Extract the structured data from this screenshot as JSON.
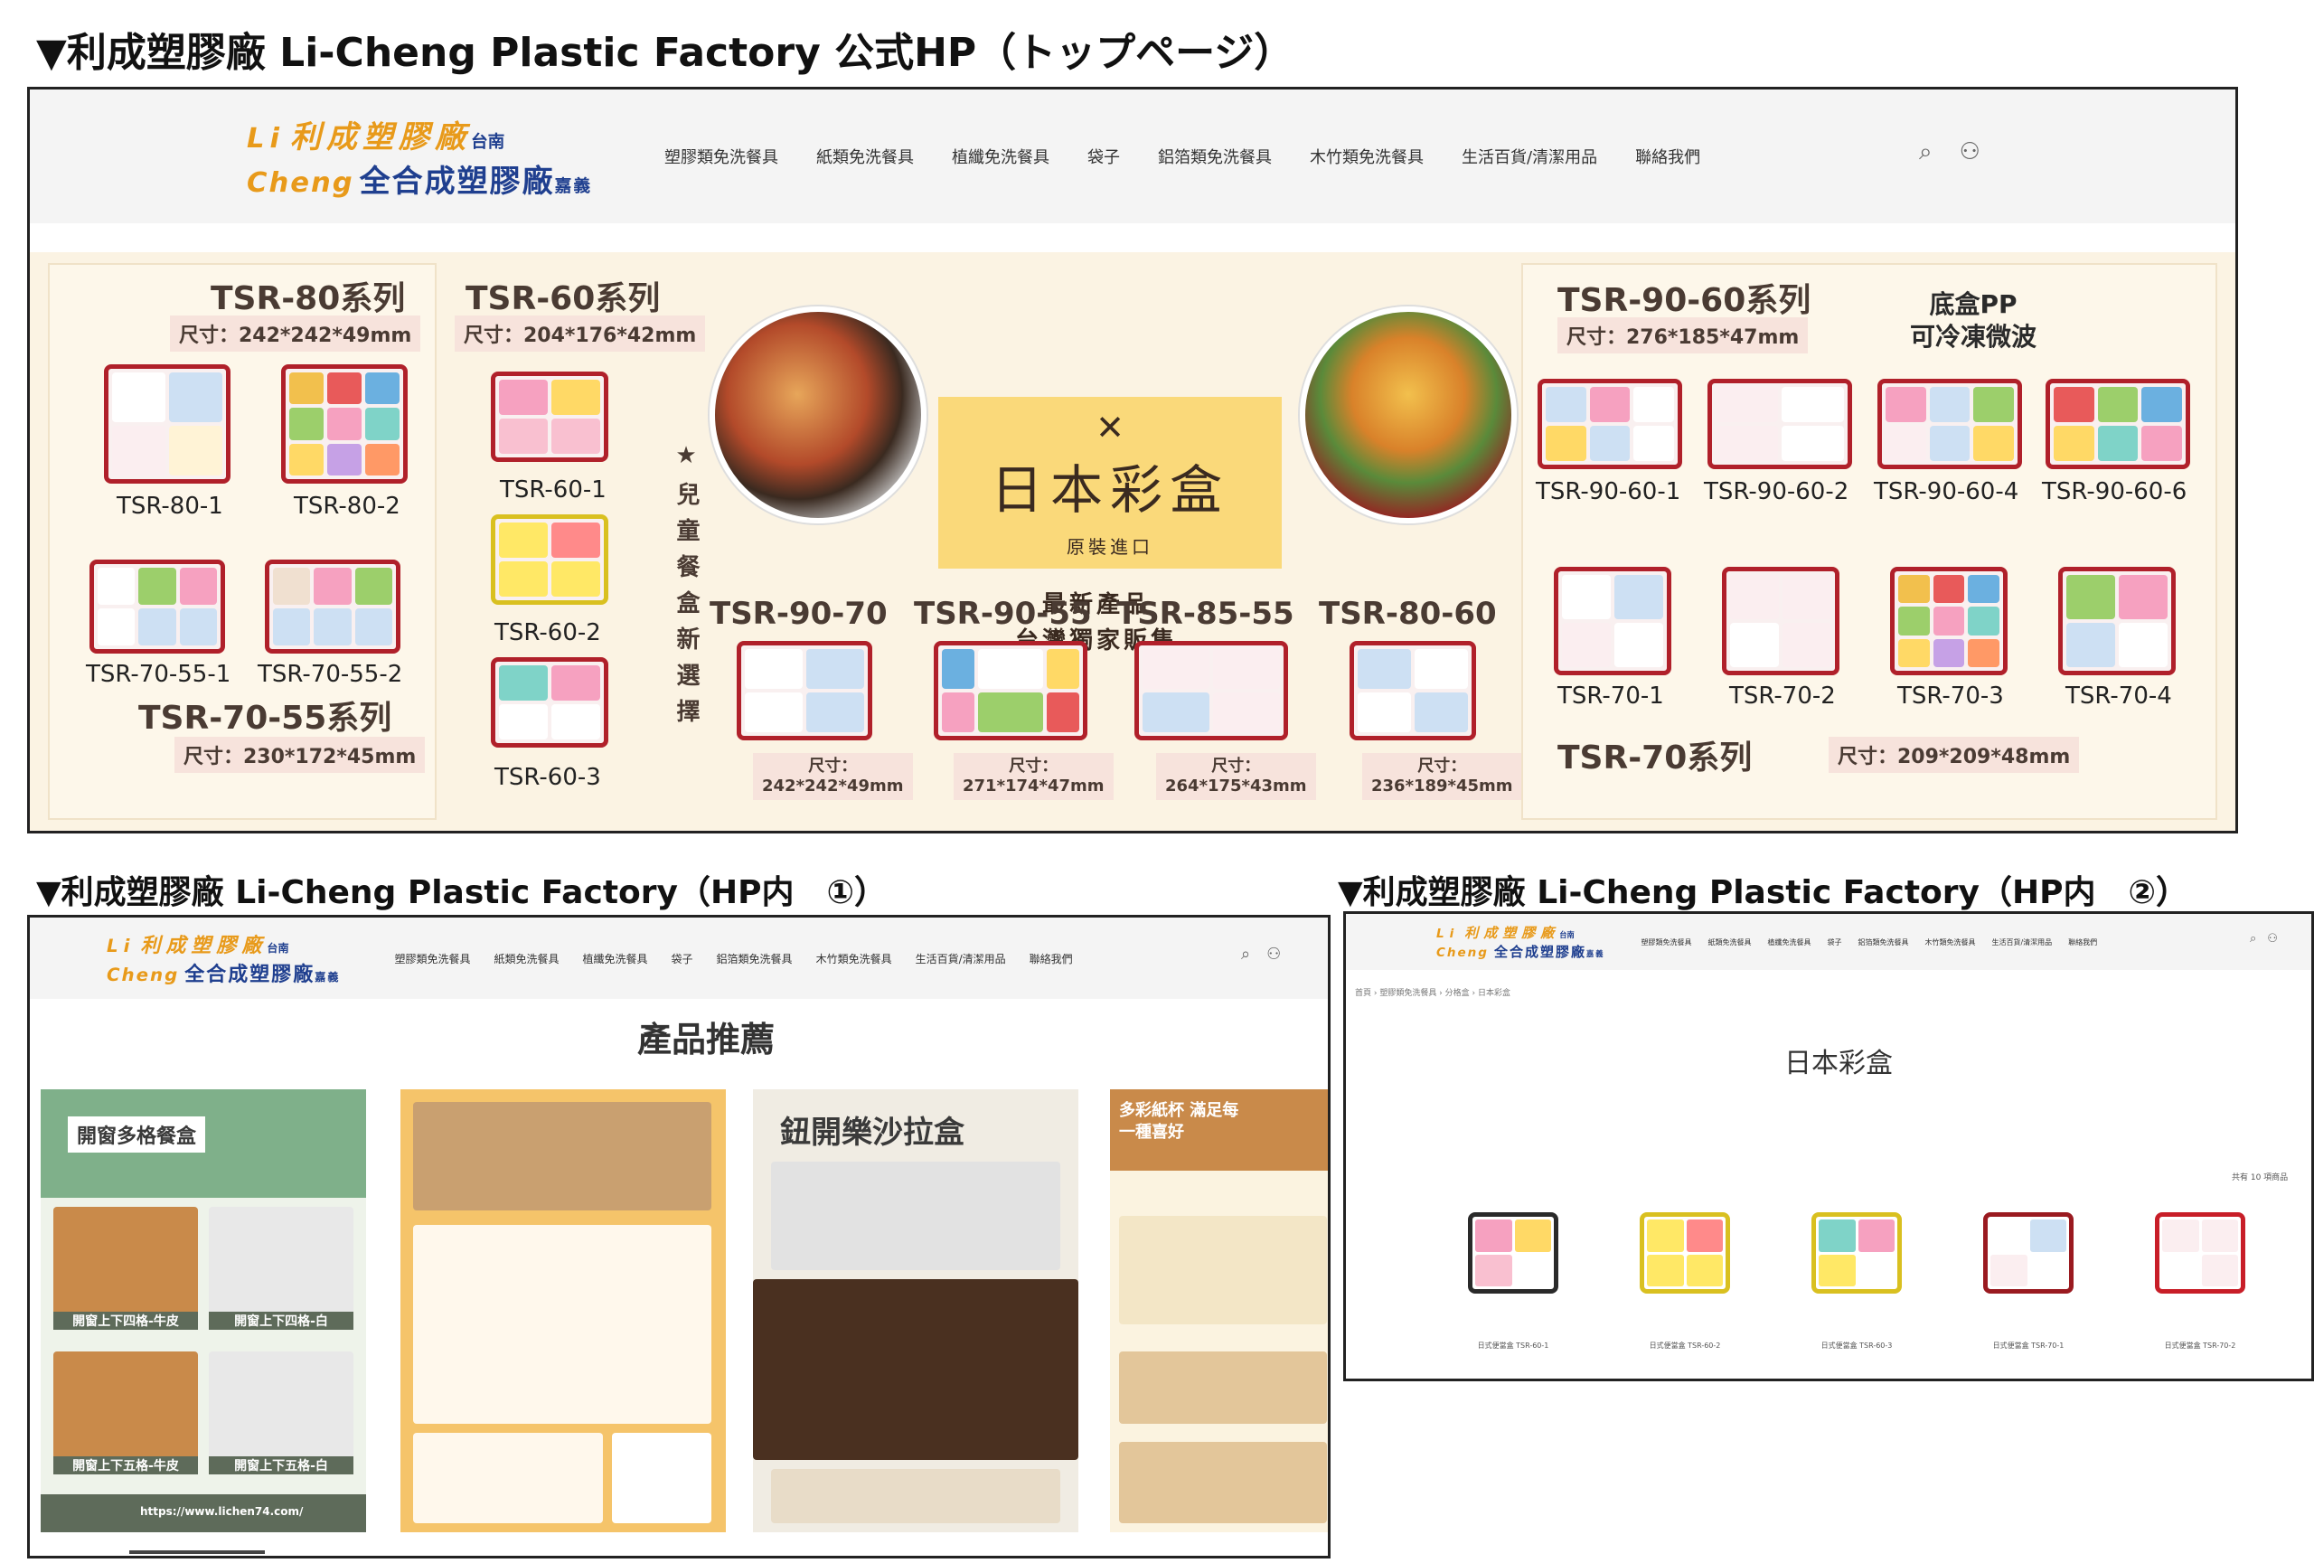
{
  "captions": {
    "top": "▼利成塑膠廠 Li-Cheng Plastic Factory 公式HP（トップページ）",
    "bottom_left": "▼利成塑膠廠 Li-Cheng Plastic Factory（HP内　①）",
    "bottom_right": "▼利成塑膠廠 Li-Cheng Plastic Factory（HP内　②）"
  },
  "logo": {
    "mark": "Li",
    "line1": "利成塑膠廠",
    "line1_sub": "台南",
    "line2": "全合成塑膠廠",
    "line2_sub": "嘉義",
    "script": "Cheng"
  },
  "nav": [
    "塑膠類免洗餐具",
    "紙類免洗餐具",
    "植纖免洗餐具",
    "袋子",
    "鋁箔類免洗餐具",
    "木竹類免洗餐具",
    "生活百貨/清潔用品",
    "聯絡我們"
  ],
  "icons": {
    "search": "search-icon",
    "user": "user-icon"
  },
  "banner": {
    "tsr80": {
      "title": "TSR-80系列",
      "dims": "尺寸：242*242*49mm",
      "items": [
        "TSR-80-1",
        "TSR-80-2"
      ]
    },
    "tsr60": {
      "title": "TSR-60系列",
      "dims": "尺寸：204*176*42mm",
      "items": [
        "TSR-60-1",
        "TSR-60-2",
        "TSR-60-3"
      ]
    },
    "tsr7055": {
      "title": "TSR-70-55系列",
      "dims": "尺寸：230*172*45mm",
      "items": [
        "TSR-70-55-1",
        "TSR-70-55-2"
      ]
    },
    "kids_tagline": "★兒童餐盒新選擇",
    "center": {
      "title": "日本彩盒",
      "sub": "原裝進口",
      "tagline1": "最新產品",
      "tagline2": "台灣獨家販售"
    },
    "middle_series": [
      {
        "title": "TSR-90-70",
        "dims": "尺寸：",
        "size": "242*242*49mm"
      },
      {
        "title": "TSR-90-55",
        "dims": "尺寸：",
        "size": "271*174*47mm"
      },
      {
        "title": "TSR-85-55",
        "dims": "尺寸：",
        "size": "264*175*43mm"
      },
      {
        "title": "TSR-80-60",
        "dims": "尺寸：",
        "size": "236*189*45mm"
      }
    ],
    "tsr9060": {
      "title": "TSR-90-60系列",
      "dims": "尺寸：276*185*47mm",
      "items": [
        "TSR-90-60-1",
        "TSR-90-60-2",
        "TSR-90-60-4",
        "TSR-90-60-6"
      ]
    },
    "pp_note": {
      "line1": "底盒PP",
      "line2": "可冷凍微波"
    },
    "tsr70": {
      "title": "TSR-70系列",
      "dims": "尺寸：209*209*48mm",
      "items": [
        "TSR-70-1",
        "TSR-70-2",
        "TSR-70-3",
        "TSR-70-4"
      ]
    }
  },
  "page1": {
    "heading": "產品推薦",
    "flyers": [
      {
        "title": "開窗多格餐盒",
        "captions": [
          "開窗上下四格-牛皮",
          "開窗上下四格-白",
          "開窗上下五格-牛皮",
          "開窗上下五格-白"
        ],
        "url": "https://www.lichen74.com/"
      },
      {
        "title": ""
      },
      {
        "title": "鈕開樂沙拉盒"
      },
      {
        "title": "多彩紙杯 滿足每一種喜好"
      }
    ]
  },
  "page2": {
    "breadcrumb": "首頁 › 塑膠類免洗餐具 › 分格盒 › 日本彩盒",
    "heading": "日本彩盒",
    "result_count": "共有 10 項商品",
    "products": [
      "日式便當盒 TSR-60-1",
      "日式便當盒 TSR-60-2",
      "日式便當盒 TSR-60-3",
      "日式便當盒 TSR-70-1",
      "日式便當盒 TSR-70-2"
    ]
  },
  "colors": {
    "logo_orange": "#e89a1a",
    "logo_blue": "#1f3f8f",
    "box_red": "#b0202a",
    "banner_bg": "#fbf3e3",
    "card_yellow": "#fad97a"
  }
}
